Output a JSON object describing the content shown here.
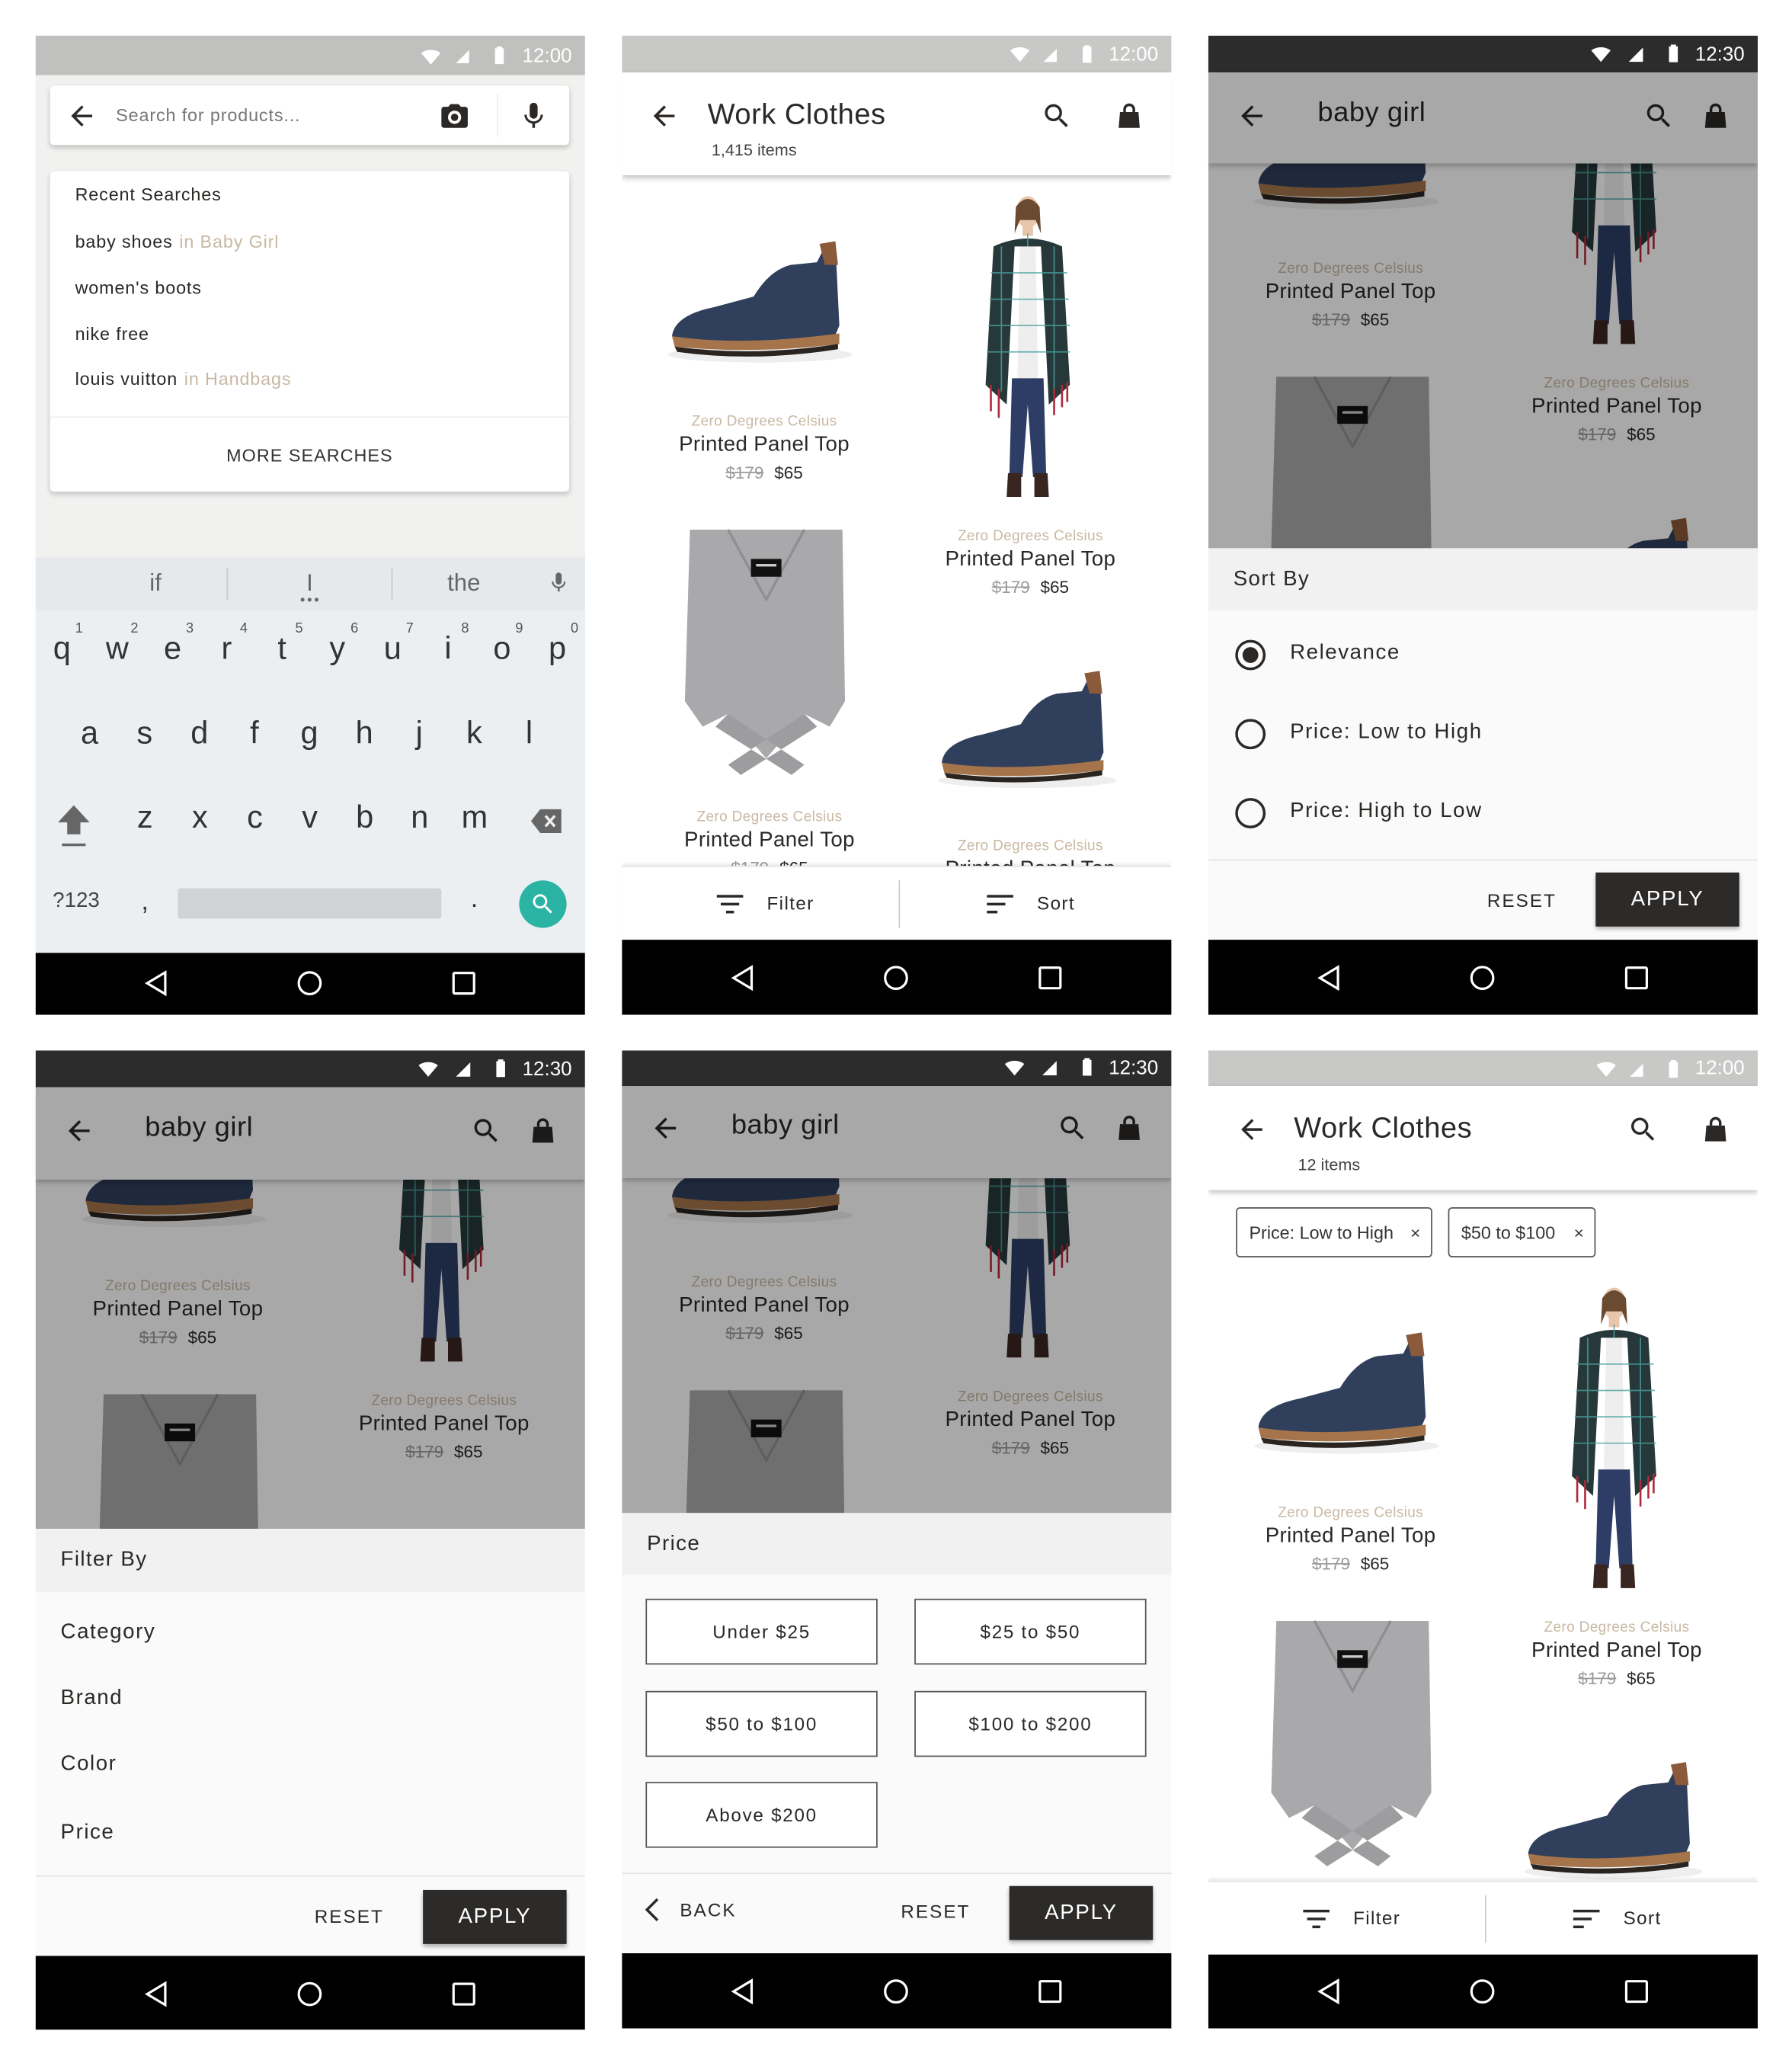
{
  "status": {
    "time_light": "12:00",
    "time_dark": "12:30"
  },
  "search_screen": {
    "placeholder": "Search for products...",
    "recent_title": "Recent Searches",
    "recent": [
      {
        "term": "baby shoes",
        "context": "in Baby Girl"
      },
      {
        "term": "women's boots",
        "context": ""
      },
      {
        "term": "nike free",
        "context": ""
      },
      {
        "term": "louis vuitton",
        "context": "in Handbags"
      }
    ],
    "more_label": "MORE SEARCHES"
  },
  "keyboard": {
    "suggestions": [
      "if",
      "I",
      "the"
    ],
    "numbers": [
      "1",
      "2",
      "3",
      "4",
      "5",
      "6",
      "7",
      "8",
      "9",
      "0"
    ],
    "row1": [
      "q",
      "w",
      "e",
      "r",
      "t",
      "y",
      "u",
      "i",
      "o",
      "p"
    ],
    "row2": [
      "a",
      "s",
      "d",
      "f",
      "g",
      "h",
      "j",
      "k",
      "l"
    ],
    "row3": [
      "z",
      "x",
      "c",
      "v",
      "b",
      "n",
      "m"
    ],
    "symbols_key": "?123",
    "comma_key": ",",
    "period_key": ".",
    "action_color": "#2bb3a3"
  },
  "work_clothes": {
    "title": "Work Clothes",
    "count": "1,415 items",
    "filtered_count": "12 items",
    "filter_label": "Filter",
    "sort_label": "Sort",
    "chips": [
      "Price: Low to High",
      "$50 to $100"
    ],
    "chip_close": "×"
  },
  "products": [
    {
      "brand": "Zero Degrees Celsius",
      "name": "Printed Panel Top",
      "original_price": "$179",
      "price": "$65",
      "image": "navy-suede-chukka-boot"
    },
    {
      "brand": "Zero Degrees Celsius",
      "name": "Printed Panel Top",
      "original_price": "$179",
      "price": "$65",
      "image": "plaid-wrap-model"
    },
    {
      "brand": "Zero Degrees Celsius",
      "name": "Printed Panel Top",
      "original_price": "$179",
      "price": "$65",
      "image": "grey-knit-wrap"
    },
    {
      "brand": "Zero Degrees Celsius",
      "name": "Printed Panel Top",
      "original_price": "$179",
      "price": "$65",
      "image": "navy-suede-chukka-boot"
    }
  ],
  "baby_girl": {
    "title": "baby girl"
  },
  "sort_sheet": {
    "heading": "Sort By",
    "options": [
      "Relevance",
      "Price: Low to High",
      "Price: High to Low"
    ],
    "selected": "Relevance",
    "reset_label": "RESET",
    "apply_label": "APPLY"
  },
  "filter_sheet": {
    "heading": "Filter By",
    "options": [
      "Category",
      "Brand",
      "Color",
      "Price"
    ],
    "reset_label": "RESET",
    "apply_label": "APPLY"
  },
  "price_sheet": {
    "heading": "Price",
    "options": [
      "Under $25",
      "$25 to $50",
      "$50 to $100",
      "$100 to $200",
      "Above $200"
    ],
    "back_label": "BACK",
    "reset_label": "RESET",
    "apply_label": "APPLY"
  },
  "colors": {
    "brand_text": "#c9b8a3",
    "apply_button": "#2d2b29",
    "text": "#2b2826"
  }
}
